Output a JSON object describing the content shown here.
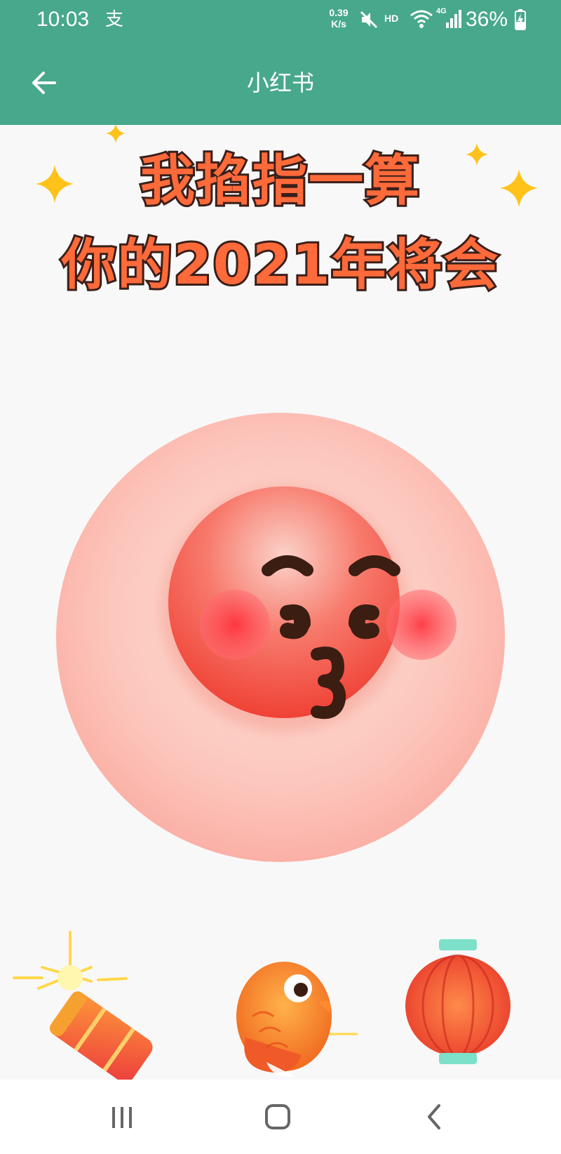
{
  "status_bar": {
    "time": "10:03",
    "app_icon_glyph": "支",
    "net_speed_value": "0.39",
    "net_speed_unit": "K/s",
    "hd_label": "HD",
    "network_label": "4G",
    "battery_percent": "36%",
    "icons": [
      "alipay-icon",
      "mute-icon",
      "wifi-icon",
      "signal-icon",
      "battery-charging-icon"
    ]
  },
  "toolbar": {
    "title": "小红书",
    "back_icon": "arrow-left-icon"
  },
  "content": {
    "headline_line1": "我掐指一算",
    "headline_line2": "你的2021年将会",
    "headline_color": "#ff6a3a",
    "face_emoji": "kissing-face",
    "decorations": [
      "sparkle-icon",
      "firecracker-icon",
      "koi-fish-icon",
      "red-lantern-icon"
    ]
  },
  "nav_bar": {
    "buttons": [
      "recents-icon",
      "home-icon",
      "back-icon"
    ]
  },
  "colors": {
    "accent": "#48a88c",
    "face_red": "#f0473a",
    "circle_pink": "#fbb0a6"
  }
}
